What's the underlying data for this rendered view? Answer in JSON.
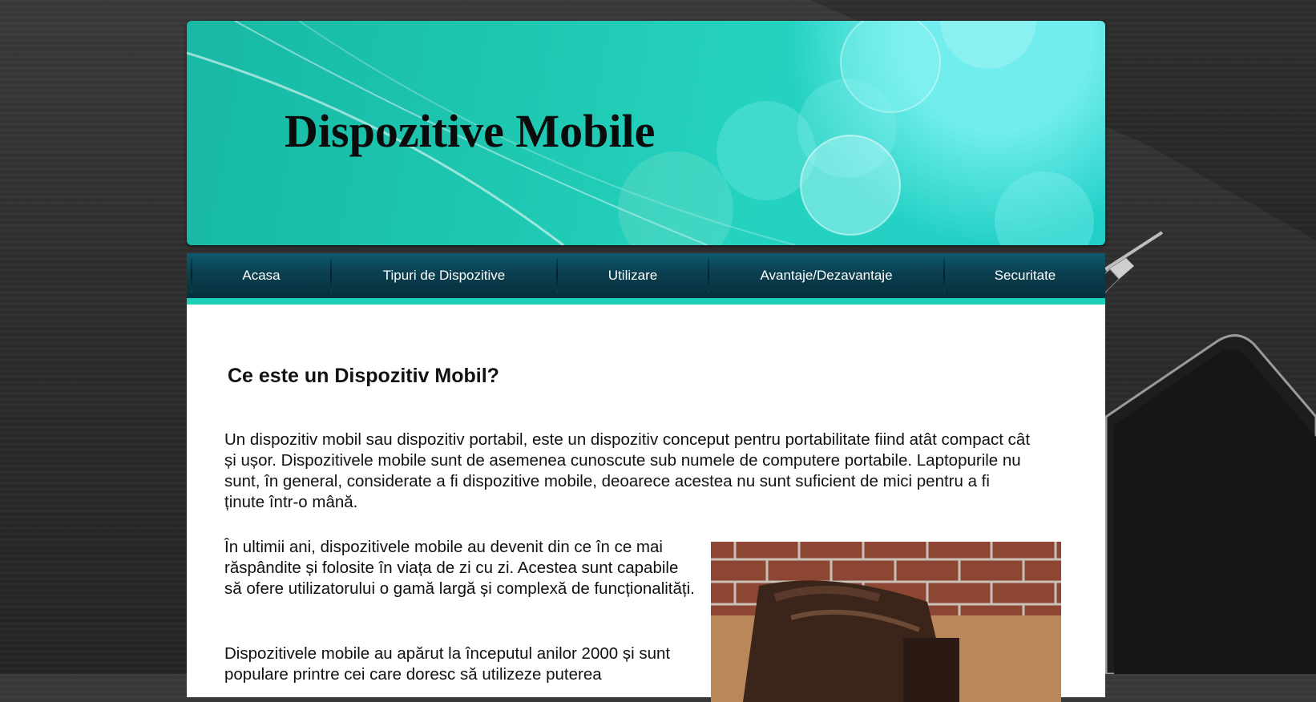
{
  "site": {
    "title": "Dispozitive Mobile"
  },
  "nav": {
    "items": [
      {
        "label": "Acasa"
      },
      {
        "label": "Tipuri de Dispozitive"
      },
      {
        "label": "Utilizare"
      },
      {
        "label": "Avantaje/Dezavantaje"
      },
      {
        "label": "Securitate"
      }
    ]
  },
  "main": {
    "heading": "Ce este un Dispozitiv Mobil?",
    "paragraph1": "Un dispozitiv mobil sau dispozitiv portabil, este un dispozitiv conceput pentru portabilitate fiind atât compact cât și ușor. Dispozitivele mobile sunt de asemenea cunoscute sub numele de computere portabile. Laptopurile nu sunt, în general, considerate a fi dispozitive mobile, deoarece acestea nu sunt suficient de mici pentru a fi ținute într-o mână.",
    "paragraph2": "În ultimii ani, dispozitivele mobile au devenit din ce în ce mai răspândite și folosite în viața de zi cu zi. Acestea sunt capabile să ofere utilizatorului o gamă largă și complexă de funcționalități.",
    "paragraph3": "Dispozitivele mobile au apărut la începutul anilor 2000 și sunt populare printre cei care doresc să utilizeze puterea"
  },
  "colors": {
    "banner": "#1ec7b0",
    "nav": "#0a3f50",
    "accent": "#1ecfb8"
  }
}
